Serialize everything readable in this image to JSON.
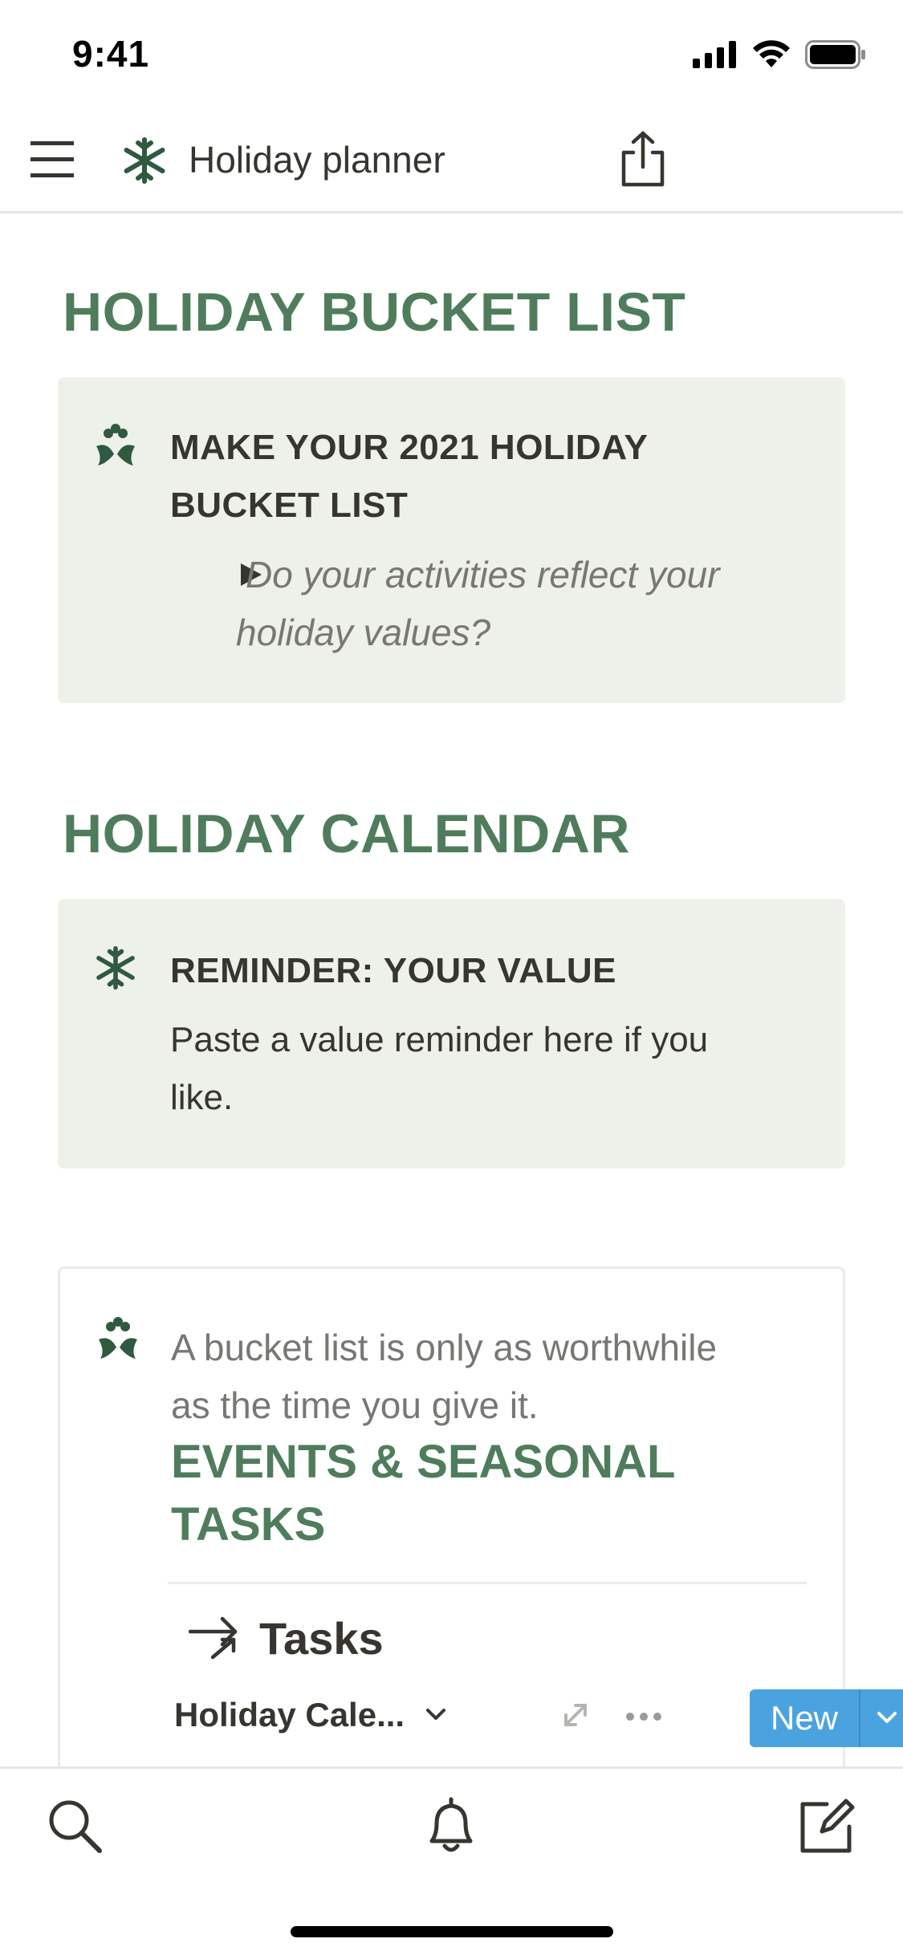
{
  "status_bar": {
    "time": "9:41"
  },
  "nav": {
    "title": "Holiday planner"
  },
  "sections": {
    "bucket_list_heading": "HOLIDAY BUCKET LIST",
    "bucket_callout": {
      "heading_line1": "MAKE YOUR 2021 HOLIDAY",
      "heading_line2": "BUCKET LIST",
      "toggle_line1": "Do your activities reflect your",
      "toggle_line2": "holiday values?"
    },
    "calendar_heading": "HOLIDAY CALENDAR",
    "reminder_callout": {
      "heading": "REMINDER: YOUR VALUE",
      "body_line1": "Paste a value reminder here if you",
      "body_line2": "like."
    }
  },
  "card": {
    "text_line1": "A bucket list is only as worthwhile",
    "text_line2": "as the time you give it.",
    "heading_line1": "EVENTS & SEASONAL",
    "heading_line2": "TASKS",
    "db_title": "Tasks",
    "view_name": "Holiday Cale...",
    "new_button": "New"
  },
  "colors": {
    "accent_green": "#4f7d5c",
    "icon_green": "#2f5a40",
    "callout_bg": "#edf1ea",
    "new_button_blue": "#4aa3df"
  },
  "icons": [
    "snowflake-icon",
    "menu-icon",
    "share-icon",
    "holly-icon",
    "toggle-arrow-icon",
    "arrow-icon",
    "chevron-down-icon",
    "expand-icon",
    "more-icon",
    "search-icon",
    "bell-icon",
    "compose-icon"
  ]
}
